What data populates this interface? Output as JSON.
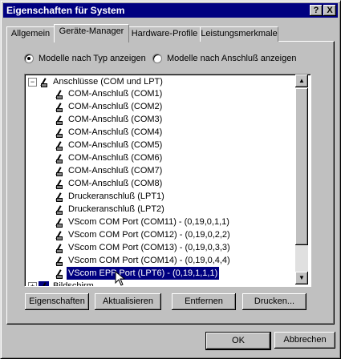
{
  "window": {
    "title": "Eigenschaften für System",
    "help_btn": "?",
    "close_btn": "X"
  },
  "tabs": [
    {
      "label": "Allgemein"
    },
    {
      "label": "Geräte-Manager"
    },
    {
      "label": "Hardware-Profile"
    },
    {
      "label": "Leistungsmerkmale"
    }
  ],
  "view_options": {
    "by_type": "Modelle nach Typ anzeigen",
    "by_connection": "Modelle nach Anschluß anzeigen"
  },
  "tree": {
    "root": "Anschlüsse (COM und LPT)",
    "items": [
      "COM-Anschluß (COM1)",
      "COM-Anschluß (COM2)",
      "COM-Anschluß (COM3)",
      "COM-Anschluß (COM4)",
      "COM-Anschluß (COM5)",
      "COM-Anschluß (COM6)",
      "COM-Anschluß (COM7)",
      "COM-Anschluß (COM8)",
      "Druckeranschluß (LPT1)",
      "Druckeranschluß (LPT2)",
      "VScom COM Port (COM11) - (0,19,0,1,1)",
      "VScom COM Port (COM12) - (0,19,0,2,2)",
      "VScom COM Port (COM13) - (0,19,0,3,3)",
      "VScom COM Port (COM14) - (0,19,0,4,4)",
      "VScom EPP Port (LPT6) - (0,19,1,1,1)"
    ],
    "next_group": "Bildschirm"
  },
  "buttons": {
    "properties": "Eigenschaften",
    "refresh": "Aktualisieren",
    "remove": "Entfernen",
    "print": "Drucken...",
    "ok": "OK",
    "cancel": "Abbrechen"
  }
}
